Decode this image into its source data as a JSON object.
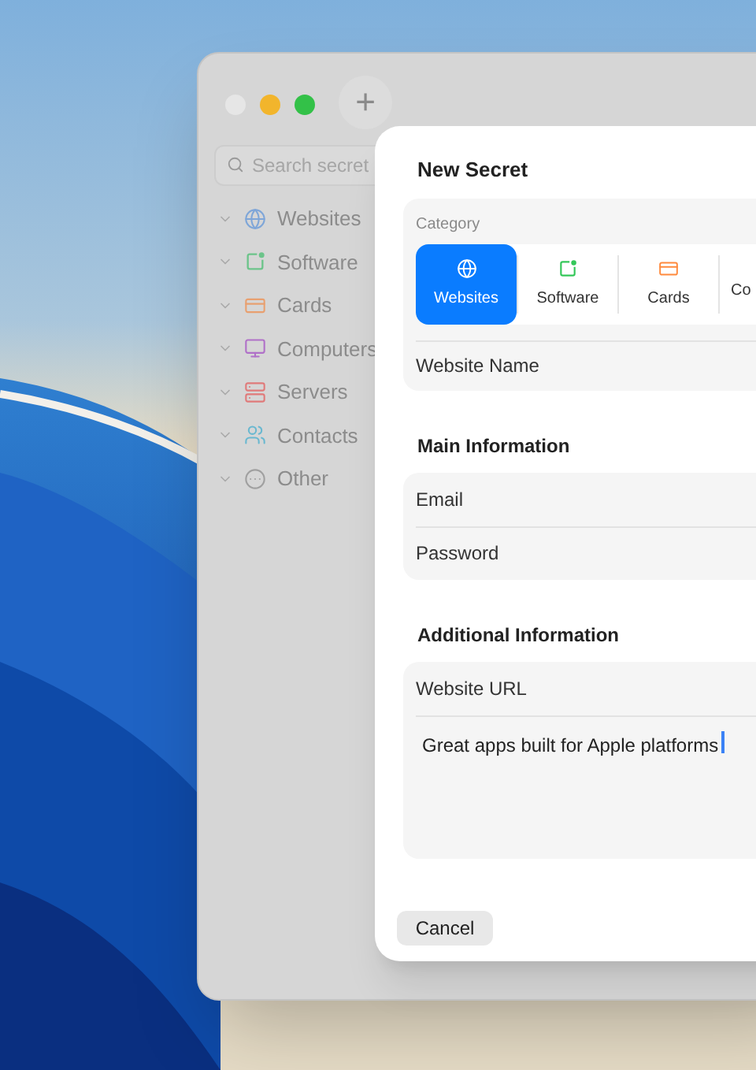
{
  "window": {
    "add_button": "+",
    "search": {
      "placeholder": "Search secret"
    },
    "sidebar": {
      "items": [
        {
          "label": "Websites",
          "kind": "globe",
          "color": "#7fa6d8"
        },
        {
          "label": "Software",
          "kind": "app",
          "color": "#6cc48a"
        },
        {
          "label": "Cards",
          "kind": "card",
          "color": "#e8a070"
        },
        {
          "label": "Computers",
          "kind": "computer",
          "color": "#b070c8"
        },
        {
          "label": "Servers",
          "kind": "server",
          "color": "#e07a7a"
        },
        {
          "label": "Contacts",
          "kind": "contacts",
          "color": "#6ab8d0"
        },
        {
          "label": "Other",
          "kind": "other",
          "color": "#a0a0a0"
        }
      ]
    }
  },
  "sheet": {
    "title": "New Secret",
    "category": {
      "label": "Category",
      "tabs": [
        {
          "label": "Websites",
          "kind": "globe",
          "selected": true
        },
        {
          "label": "Software",
          "kind": "app",
          "selected": false
        },
        {
          "label": "Cards",
          "kind": "card",
          "selected": false
        },
        {
          "label": "Co",
          "selected": false
        }
      ]
    },
    "name_field": {
      "placeholder": "Website Name"
    },
    "sections": [
      {
        "title": "Main Information",
        "fields": [
          {
            "placeholder": "Email"
          },
          {
            "placeholder": "Password"
          }
        ]
      },
      {
        "title": "Additional Information",
        "fields": [
          {
            "placeholder": "Website URL"
          }
        ],
        "notes": {
          "value": "Great apps built for Apple platforms"
        }
      }
    ],
    "cancel_button": "Cancel"
  }
}
